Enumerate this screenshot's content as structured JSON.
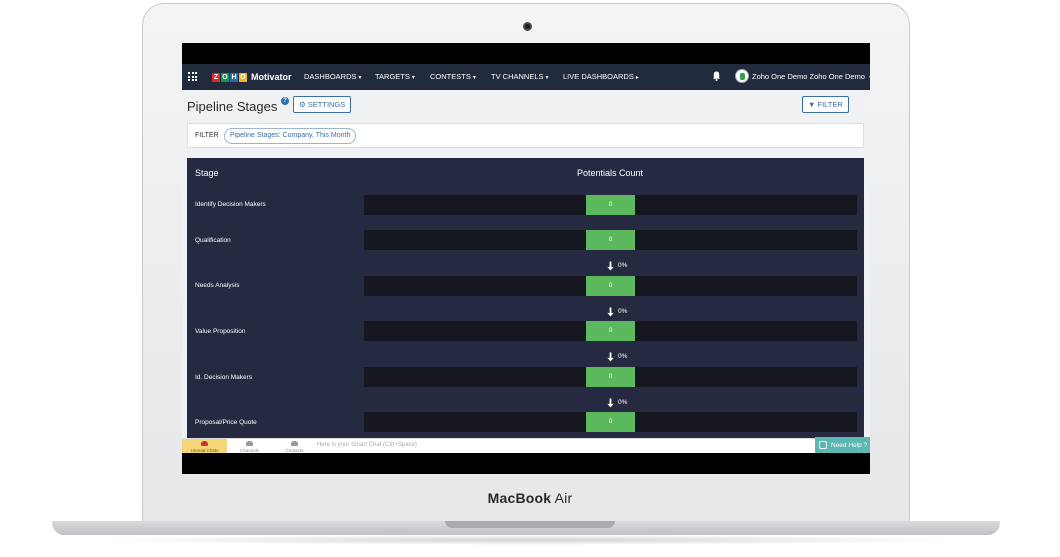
{
  "device": {
    "brand_main": "MacBook",
    "brand_sub": "Air"
  },
  "nav": {
    "logo_letters": [
      "Z",
      "O",
      "H",
      "O"
    ],
    "logo_colors": [
      "#e42527",
      "#089949",
      "#226db4",
      "#f9b21d"
    ],
    "app_name": "Motivator",
    "items": [
      {
        "label": "DASHBOARDS",
        "caret": "▾"
      },
      {
        "label": "TARGETS",
        "caret": "▾"
      },
      {
        "label": "CONTESTS",
        "caret": "▾"
      },
      {
        "label": "TV CHANNELS",
        "caret": "▾"
      },
      {
        "label": "LIVE DASHBOARDS",
        "caret": "▸"
      }
    ],
    "user": "Zoho One Demo Zoho One Demo",
    "user_caret": "▾"
  },
  "header": {
    "title": "Pipeline Stages",
    "help": "?",
    "settings_label": "⚙ SETTINGS",
    "filter_label": "▼ FILTER"
  },
  "filter_bar": {
    "label": "FILTER",
    "chip": "Pipeline Stages: Company, This Month"
  },
  "table": {
    "col_stage": "Stage",
    "col_count": "Potentials Count",
    "stages": [
      {
        "name": "Identify Decision Makers",
        "count": "0"
      },
      {
        "name": "Qualification",
        "count": "0",
        "conversion": "0%"
      },
      {
        "name": "Needs Analysis",
        "count": "0",
        "conversion": "0%"
      },
      {
        "name": "Value Proposition",
        "count": "0",
        "conversion": "0%"
      },
      {
        "name": "Id. Decision Makers",
        "count": "0",
        "conversion": "0%"
      },
      {
        "name": "Proposal/Price Quote",
        "count": "0"
      }
    ],
    "bar_color": "#5cb85c"
  },
  "chat": {
    "tabs": [
      "Unread Chats",
      "Channels",
      "Contacts"
    ],
    "unread_badge": "1",
    "placeholder": "Here is your Smart Chat (Ctrl+Space)",
    "help_button": "Need Help ?"
  }
}
